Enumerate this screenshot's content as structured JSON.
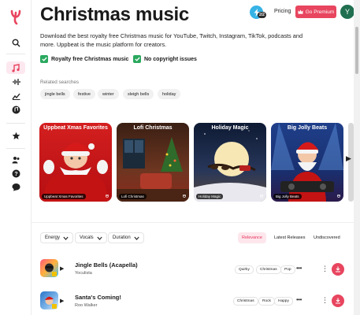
{
  "header": {
    "title": "Christmas music",
    "badge_count": "2/2",
    "pricing_label": "Pricing",
    "premium_label": "Go Premium",
    "avatar_letter": "Y"
  },
  "description": "Download the best royalty free Christmas music for YouTube, Twitch, Instagram, TikTok, podcasts and more. Uppbeat is the music platform for creators.",
  "features": [
    "Royalty free Christmas music",
    "No copyright issues"
  ],
  "related": {
    "label": "Related searches",
    "chips": [
      "jingle bells",
      "festive",
      "winter",
      "sleigh bells",
      "holiday"
    ]
  },
  "playlists": [
    {
      "title": "Uppbeat Xmas Favorites",
      "caption": "Uppbeat Xmas Favorites"
    },
    {
      "title": "Lofi Christmas",
      "caption": "Lofi Christmas"
    },
    {
      "title": "Holiday Magic",
      "caption": "Holiday Magic"
    },
    {
      "title": "Big Jolly Beats",
      "caption": "Big Jolly Beats"
    }
  ],
  "filters": [
    "Energy",
    "Vocals",
    "Duration"
  ],
  "sort_tabs": [
    "Relevance",
    "Latest Releases",
    "Undiscovered"
  ],
  "tracks": [
    {
      "title": "Jingle Bells (Acapella)",
      "artist": "Yoculista",
      "tags": [
        "Quirky",
        "Christmas",
        "Pop"
      ]
    },
    {
      "title": "Santa's Coming!",
      "artist": "Roo Walker",
      "tags": [
        "Christmas",
        "Rock",
        "Happy"
      ]
    }
  ],
  "colors": {
    "accent": "#e8455f",
    "check": "#2aa85e",
    "bolt": "#36b3e6",
    "avatar": "#1f6f50"
  }
}
